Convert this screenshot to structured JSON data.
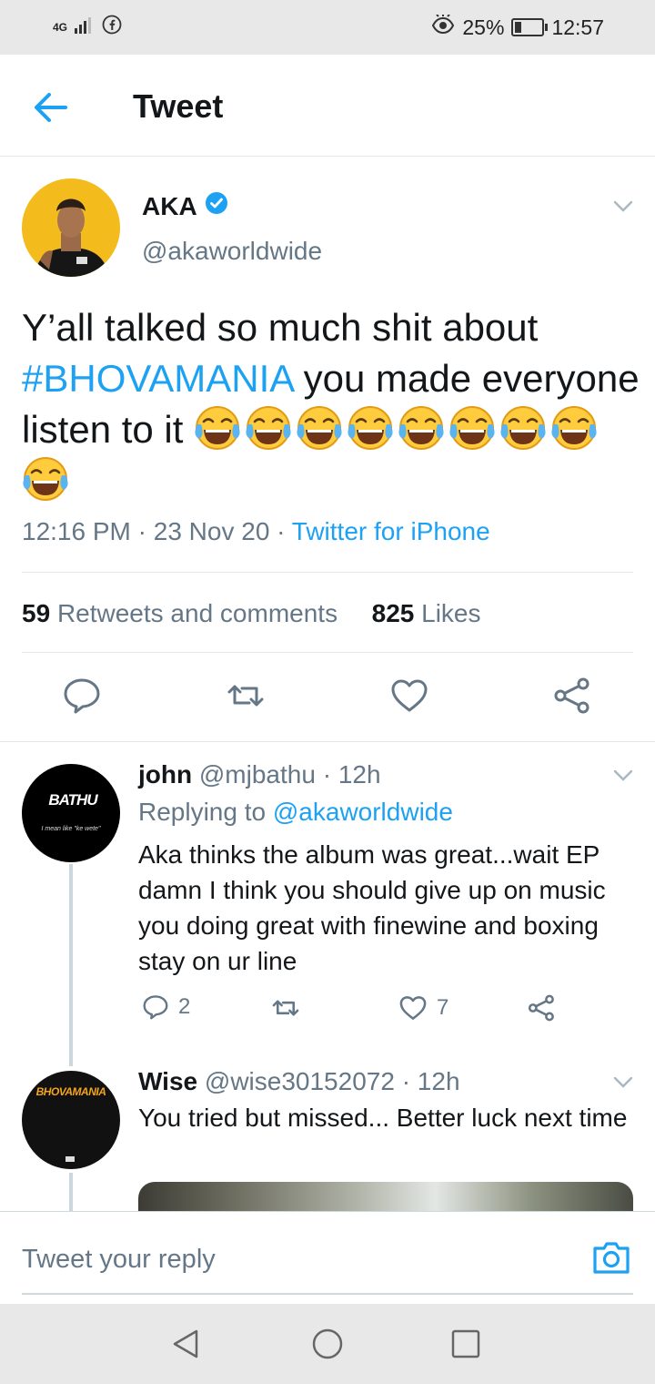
{
  "status_bar": {
    "network": "4G",
    "battery_percent": "25%",
    "battery_level": 0.25,
    "time": "12:57"
  },
  "header": {
    "title": "Tweet"
  },
  "tweet": {
    "author_name": "AKA",
    "author_handle": "@akaworldwide",
    "text_before": "Y’all talked so much shit about ",
    "hashtag": "#BHOVAMANIA",
    "text_after": " you made everyone listen to it ",
    "emoji_count": 9,
    "time": "12:16 PM",
    "date": "23 Nov 20",
    "source": "Twitter for iPhone",
    "retweets_count": "59",
    "retweets_label": "Retweets and comments",
    "likes_count": "825",
    "likes_label": "Likes"
  },
  "replies": [
    {
      "name": "john",
      "handle": "@mjbathu",
      "age": "12h",
      "replying_label": "Replying to",
      "replying_to": "@akaworldwide",
      "text": "Aka thinks the album was great...wait EP damn I think you should give up on music you doing great with finewine and boxing stay on ur line",
      "avatar_text": "BATHU",
      "avatar_subtext": "I mean like \"ke wete\"",
      "reply_count": "2",
      "like_count": "7"
    },
    {
      "name": "Wise",
      "handle": "@wise30152072",
      "age": "12h",
      "text": "You tried but missed... Better luck next time",
      "avatar_text": "BHOVAMANIA"
    }
  ],
  "composer": {
    "placeholder": "Tweet your reply"
  },
  "colors": {
    "accent": "#1da1f2",
    "muted": "#657786",
    "text": "#14171a"
  }
}
